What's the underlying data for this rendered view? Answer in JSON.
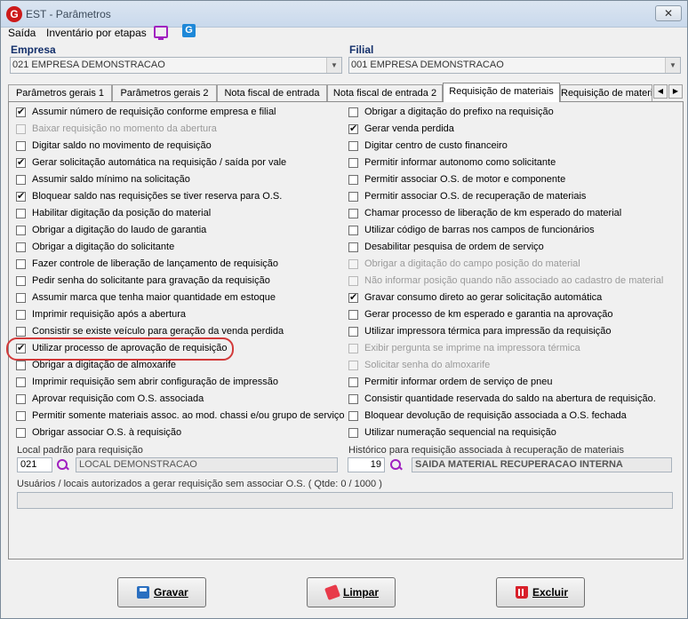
{
  "window": {
    "title": "EST - Parâmetros",
    "close": "✕",
    "logo": "G"
  },
  "menu": {
    "items": [
      "Saída",
      "Inventário por etapas"
    ]
  },
  "empresa": {
    "label": "Empresa",
    "value": "021 EMPRESA DEMONSTRACAO"
  },
  "filial": {
    "label": "Filial",
    "value": "001 EMPRESA DEMONSTRACAO"
  },
  "tabs": [
    "Parâmetros gerais 1",
    "Parâmetros gerais 2",
    "Nota fiscal de entrada",
    "Nota fiscal de entrada 2",
    "Requisição de materiais",
    "Requisição de materi"
  ],
  "tab_scroll": {
    "left": "◀",
    "right": "▶"
  },
  "left_options": [
    {
      "label": "Assumir número de requisição conforme empresa e filial",
      "checked": true,
      "disabled": false
    },
    {
      "label": "Baixar requisição no momento da abertura",
      "checked": false,
      "disabled": true
    },
    {
      "label": "Digitar saldo no movimento de requisição",
      "checked": false,
      "disabled": false
    },
    {
      "label": "Gerar solicitação automática na requisição / saída por vale",
      "checked": true,
      "disabled": false
    },
    {
      "label": "Assumir saldo mínimo na solicitação",
      "checked": false,
      "disabled": false
    },
    {
      "label": "Bloquear saldo nas requisições se tiver reserva para O.S.",
      "checked": true,
      "disabled": false
    },
    {
      "label": "Habilitar digitação da posição do material",
      "checked": false,
      "disabled": false
    },
    {
      "label": "Obrigar a digitação do laudo de garantia",
      "checked": false,
      "disabled": false
    },
    {
      "label": "Obrigar a digitação do solicitante",
      "checked": false,
      "disabled": false
    },
    {
      "label": "Fazer controle de liberação de lançamento de requisição",
      "checked": false,
      "disabled": false
    },
    {
      "label": "Pedir senha do solicitante para gravação da requisição",
      "checked": false,
      "disabled": false
    },
    {
      "label": "Assumir marca que tenha maior quantidade em estoque",
      "checked": false,
      "disabled": false
    },
    {
      "label": "Imprimir requisição após a abertura",
      "checked": false,
      "disabled": false
    },
    {
      "label": "Consistir se existe veículo para geração da venda perdida",
      "checked": false,
      "disabled": false
    },
    {
      "label": "Utilizar processo de aprovação de requisição",
      "checked": true,
      "disabled": false
    },
    {
      "label": "Obrigar a digitação de almoxarife",
      "checked": false,
      "disabled": false
    },
    {
      "label": "Imprimir requisição sem abrir configuração de impressão",
      "checked": false,
      "disabled": false
    },
    {
      "label": "Aprovar requisição com O.S. associada",
      "checked": false,
      "disabled": false
    },
    {
      "label": "Permitir somente materiais assoc. ao mod. chassi e/ou grupo de serviço",
      "checked": false,
      "disabled": false
    },
    {
      "label": "Obrigar associar O.S. à requisição",
      "checked": false,
      "disabled": false
    }
  ],
  "right_options": [
    {
      "label": "Obrigar a digitação do prefixo na requisição",
      "checked": false,
      "disabled": false
    },
    {
      "label": "Gerar venda perdida",
      "checked": true,
      "disabled": false
    },
    {
      "label": "Digitar centro de custo financeiro",
      "checked": false,
      "disabled": false
    },
    {
      "label": "Permitir informar autonomo como solicitante",
      "checked": false,
      "disabled": false
    },
    {
      "label": "Permitir associar O.S. de motor e componente",
      "checked": false,
      "disabled": false
    },
    {
      "label": "Permitir associar O.S. de recuperação de materiais",
      "checked": false,
      "disabled": false
    },
    {
      "label": "Chamar processo de liberação de km esperado do material",
      "checked": false,
      "disabled": false
    },
    {
      "label": "Utilizar código de barras nos campos de funcionários",
      "checked": false,
      "disabled": false
    },
    {
      "label": "Desabilitar pesquisa de ordem de serviço",
      "checked": false,
      "disabled": false
    },
    {
      "label": "Obrigar a digitação do campo posição do material",
      "checked": false,
      "disabled": true
    },
    {
      "label": "Não informar posição quando não associado ao cadastro de material",
      "checked": false,
      "disabled": true
    },
    {
      "label": "Gravar consumo direto ao gerar solicitação automática",
      "checked": true,
      "disabled": false
    },
    {
      "label": "Gerar processo de km esperado e garantia na aprovação",
      "checked": false,
      "disabled": false
    },
    {
      "label": "Utilizar impressora térmica para impressão da requisição",
      "checked": false,
      "disabled": false
    },
    {
      "label": "Exibir pergunta se imprime na impressora térmica",
      "checked": false,
      "disabled": true
    },
    {
      "label": "Solicitar senha do almoxarife",
      "checked": false,
      "disabled": true
    },
    {
      "label": "Permitir informar ordem de serviço de pneu",
      "checked": false,
      "disabled": false
    },
    {
      "label": "Consistir quantidade reservada do saldo na abertura de requisição.",
      "checked": false,
      "disabled": false
    },
    {
      "label": "Bloquear devolução de requisição associada a O.S. fechada",
      "checked": false,
      "disabled": false
    },
    {
      "label": "Utilizar numeração sequencial na requisição",
      "checked": false,
      "disabled": false
    }
  ],
  "local": {
    "label": "Local padrão para requisição",
    "code": "021",
    "name": "LOCAL DEMONSTRACAO"
  },
  "historico": {
    "label": "Histórico para requisição associada à recuperação de materiais",
    "code": "19",
    "name": "SAIDA MATERIAL RECUPERACAO INTERNA"
  },
  "usuarios": {
    "label": "Usuários / locais autorizados a gerar requisição sem associar O.S.  ( Qtde: 0 / 1000 )",
    "value": ""
  },
  "buttons": {
    "save": "Gravar",
    "clear": "Limpar",
    "delete": "Excluir"
  },
  "colors": {
    "accent": "#14306b",
    "highlight": "#d23a3a",
    "icon": "#a020c0"
  }
}
